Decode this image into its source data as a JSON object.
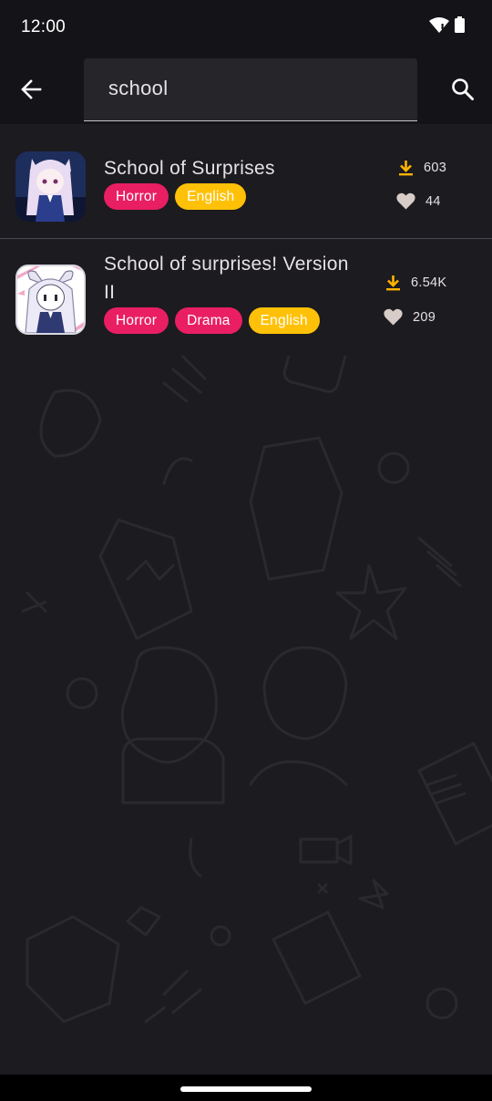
{
  "status_bar": {
    "time": "12:00"
  },
  "search": {
    "query": "school"
  },
  "colors": {
    "background": "#1c1b1f",
    "tag_genre": "#e91e63",
    "tag_language": "#ffc107",
    "download_icon": "#ffb300",
    "heart_icon": "#d7ccc8"
  },
  "results": [
    {
      "title": "School of Surprises",
      "tags": [
        "Horror",
        "English"
      ],
      "downloads": "603",
      "likes": "44",
      "icons": {
        "download": "download-icon",
        "like": "heart-icon"
      }
    },
    {
      "title_line1": "School of surprises! Version",
      "title_line2": "II",
      "tags": [
        "Horror",
        "Drama",
        "English"
      ],
      "downloads": "6.54K",
      "likes": "209",
      "icons": {
        "download": "download-icon",
        "like": "heart-icon"
      }
    }
  ]
}
